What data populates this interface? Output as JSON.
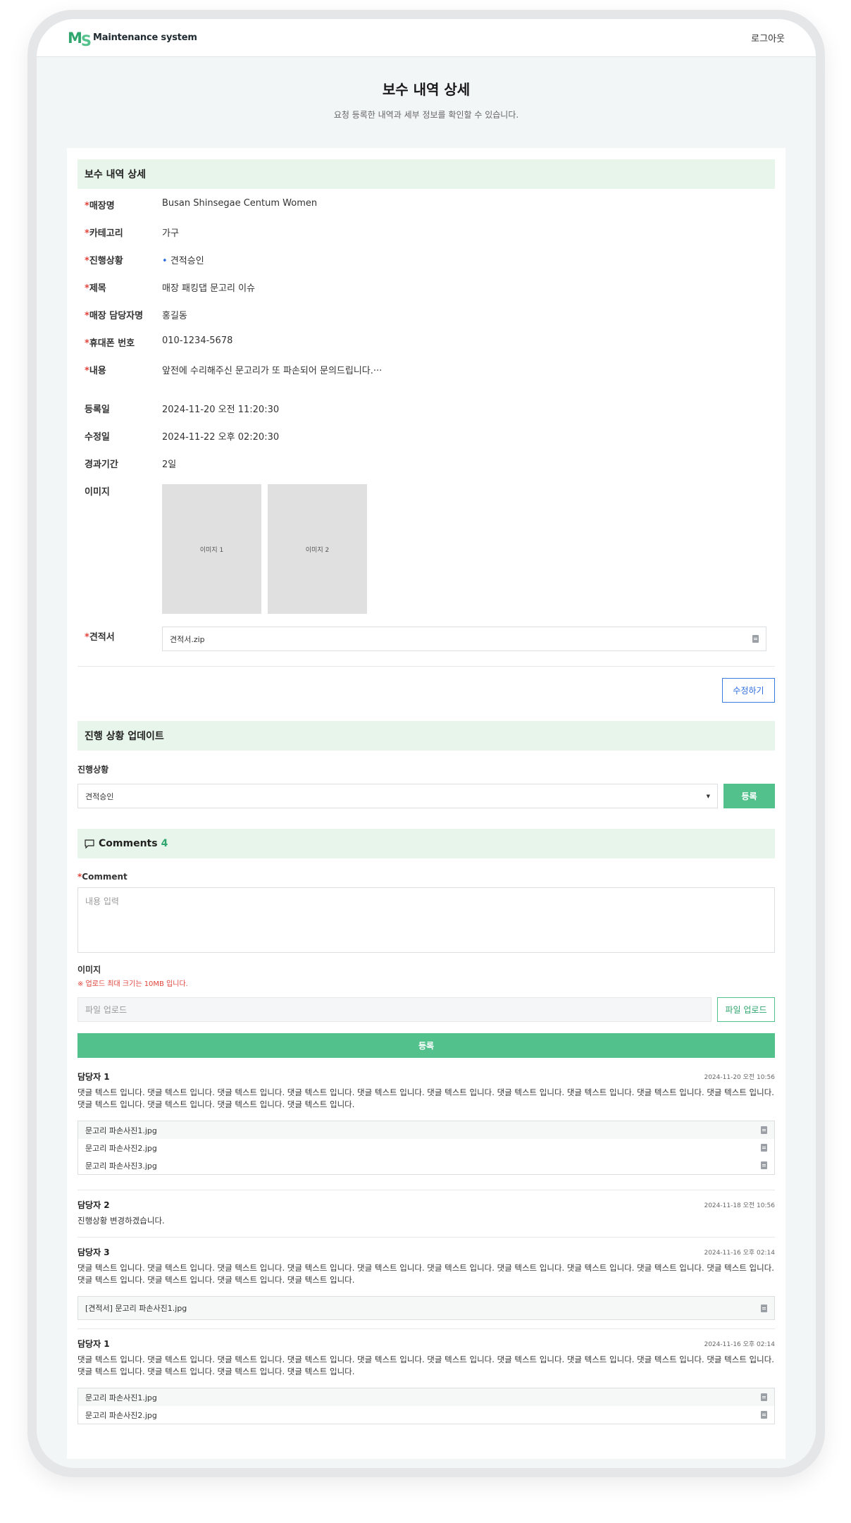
{
  "header": {
    "logo_mark_m": "M",
    "logo_mark_s": "S",
    "logo_text": "Maintenance system",
    "logout": "로그아웃"
  },
  "page": {
    "title": "보수 내역 상세",
    "subtitle": "요청 등록한 내역과 세부 정보를 확인할 수 있습니다."
  },
  "detail": {
    "section_title": "보수 내역 상세",
    "req_mark": "*",
    "fields": [
      {
        "label": "매장명",
        "value": "Busan Shinsegae Centum Women"
      },
      {
        "label": "카테고리",
        "value": "가구"
      },
      {
        "label": "진행상황",
        "value": "견적승인",
        "bullet": "•"
      },
      {
        "label": "제목",
        "value": "매장 패킹댑 문고리 이슈"
      },
      {
        "label": "매장 담당자명",
        "value": "홍길동"
      },
      {
        "label": "휴대폰 번호",
        "value": "010-1234-5678"
      },
      {
        "label": "내용",
        "value": "앞전에 수리해주신 문고리가 또 파손되어 문의드립니다.···"
      }
    ],
    "meta": [
      {
        "label": "등록일",
        "value": "2024-11-20 오전 11:20:30"
      },
      {
        "label": "수정일",
        "value": "2024-11-22 오후 02:20:30"
      },
      {
        "label": "경과기간",
        "value": "2일"
      }
    ],
    "images_label": "이미지",
    "images": [
      "이미지 1",
      "이미지 2"
    ],
    "quote_label": "견적서",
    "quote_file": "견적서.zip",
    "edit_button": "수정하기"
  },
  "progress": {
    "section_title": "진행 상황 업데이트",
    "label": "진행상황",
    "selected": "견적승인",
    "caret": "▼",
    "submit": "등록"
  },
  "comments": {
    "title": "Comments",
    "count": "4",
    "comment_label": "Comment",
    "placeholder": "내용 입력",
    "image_label": "이미지",
    "hint": "※ 업로드 최대 크기는 10MB 입니다.",
    "upload_placeholder": "파일 업로드",
    "upload_button": "파일 업로드",
    "submit": "등록",
    "list": [
      {
        "author": "담당자 1",
        "time": "2024-11-20 오전 10:56",
        "text": "댓글 텍스트 입니다. 댓글 텍스트 입니다. 댓글 텍스트 입니다. 댓글 텍스트 입니다. 댓글 텍스트 입니다. 댓글 텍스트 입니다. 댓글 텍스트 입니다. 댓글 텍스트 입니다. 댓글 텍스트 입니다. 댓글 텍스트 입니다. 댓글 텍스트 입니다. 댓글 텍스트 입니다. 댓글 텍스트 입니다. 댓글 텍스트 입니다.",
        "files": [
          "문고리 파손사진1.jpg",
          "문고리 파손사진2.jpg",
          "문고리 파손사진3.jpg"
        ]
      },
      {
        "author": "담당자 2",
        "time": "2024-11-18 오전 10:56",
        "text": "진행상황 변경하겠습니다.",
        "files": []
      },
      {
        "author": "담당자 3",
        "time": "2024-11-16 오후 02:14",
        "text": "댓글 텍스트 입니다. 댓글 텍스트 입니다. 댓글 텍스트 입니다. 댓글 텍스트 입니다. 댓글 텍스트 입니다. 댓글 텍스트 입니다. 댓글 텍스트 입니다. 댓글 텍스트 입니다. 댓글 텍스트 입니다. 댓글 텍스트 입니다. 댓글 텍스트 입니다. 댓글 텍스트 입니다. 댓글 텍스트 입니다. 댓글 텍스트 입니다.",
        "files": [
          "[견적서] 문고리 파손사진1.jpg"
        ]
      },
      {
        "author": "담당자 1",
        "time": "2024-11-16 오후 02:14",
        "text": "댓글 텍스트 입니다. 댓글 텍스트 입니다. 댓글 텍스트 입니다. 댓글 텍스트 입니다. 댓글 텍스트 입니다. 댓글 텍스트 입니다. 댓글 텍스트 입니다. 댓글 텍스트 입니다. 댓글 텍스트 입니다. 댓글 텍스트 입니다. 댓글 텍스트 입니다. 댓글 텍스트 입니다. 댓글 텍스트 입니다. 댓글 텍스트 입니다.",
        "files": [
          "문고리 파손사진1.jpg",
          "문고리 파손사진2.jpg"
        ]
      }
    ]
  }
}
